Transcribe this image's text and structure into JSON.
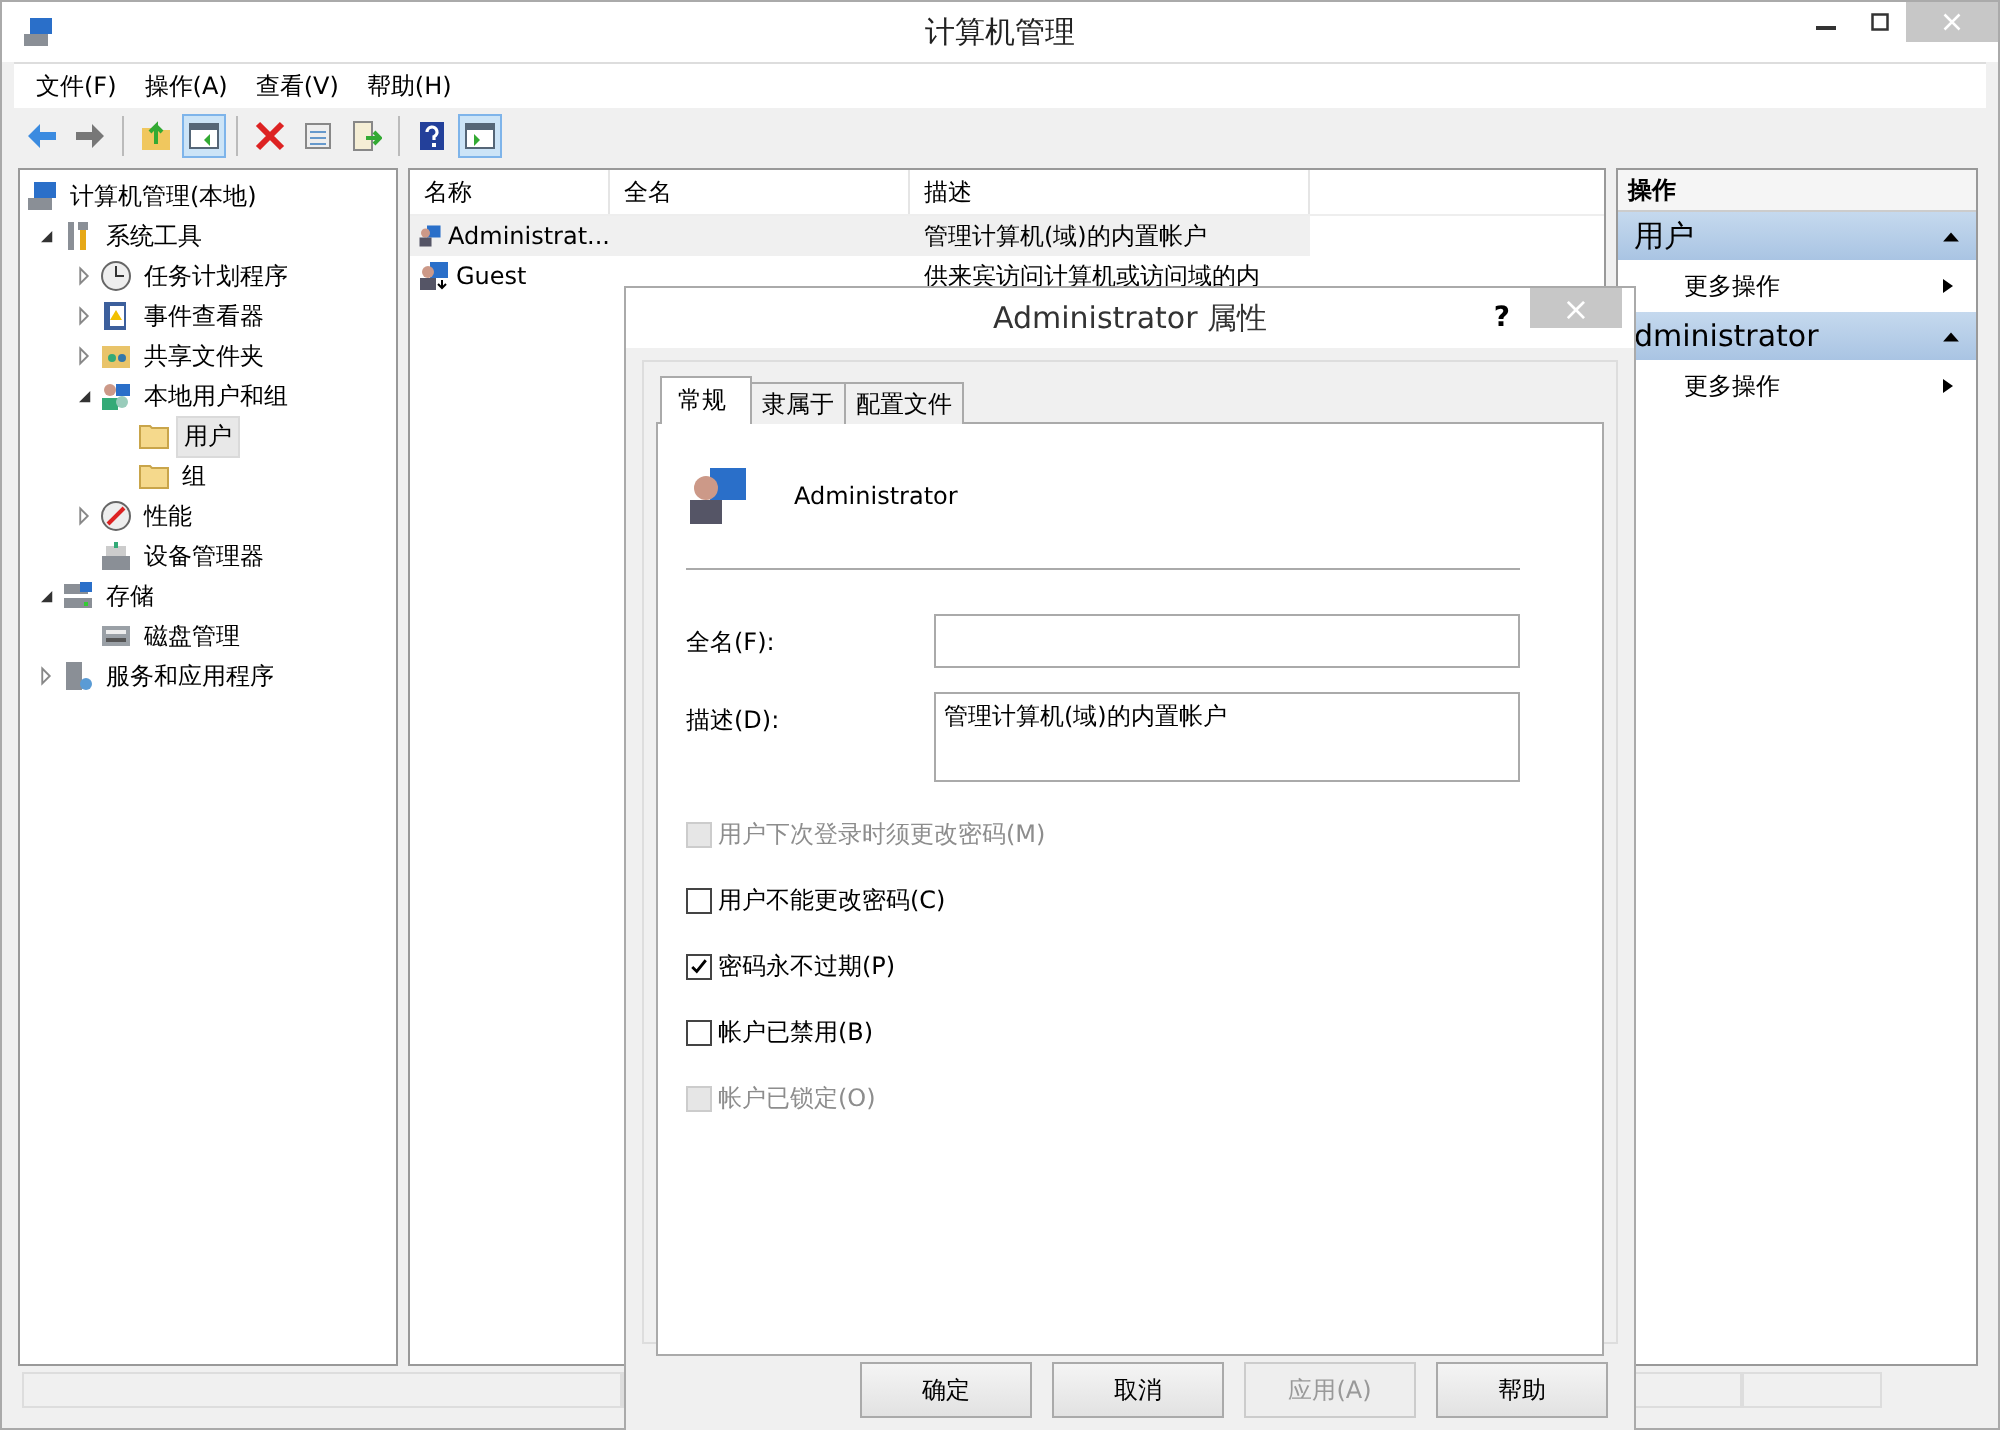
{
  "window": {
    "title": "计算机管理"
  },
  "menu": [
    "文件(F)",
    "操作(A)",
    "查看(V)",
    "帮助(H)"
  ],
  "toolbar": [
    {
      "kind": "back",
      "selected": false
    },
    {
      "kind": "forward",
      "selected": false
    },
    {
      "kind": "sep"
    },
    {
      "kind": "up",
      "selected": false
    },
    {
      "kind": "tree",
      "selected": true
    },
    {
      "kind": "sep"
    },
    {
      "kind": "delete",
      "selected": false
    },
    {
      "kind": "props",
      "selected": false
    },
    {
      "kind": "export",
      "selected": false
    },
    {
      "kind": "sep"
    },
    {
      "kind": "help",
      "selected": false
    },
    {
      "kind": "pane",
      "selected": true
    }
  ],
  "tree": [
    {
      "label": "计算机管理(本地)",
      "kind": "computer",
      "selected": false,
      "children": [
        {
          "label": "系统工具",
          "kind": "tools",
          "expanded": true,
          "selected": false,
          "children": [
            {
              "label": "任务计划程序",
              "kind": "clock",
              "expanded": false,
              "selected": false
            },
            {
              "label": "事件查看器",
              "kind": "event",
              "expanded": false,
              "selected": false
            },
            {
              "label": "共享文件夹",
              "kind": "share",
              "expanded": false,
              "selected": false
            },
            {
              "label": "本地用户和组",
              "kind": "users",
              "expanded": true,
              "selected": false,
              "children": [
                {
                  "label": "用户",
                  "kind": "folder",
                  "selected": true
                },
                {
                  "label": "组",
                  "kind": "folder",
                  "selected": false
                }
              ]
            },
            {
              "label": "性能",
              "kind": "perf",
              "expanded": false,
              "selected": false
            },
            {
              "label": "设备管理器",
              "kind": "device",
              "selected": false
            }
          ]
        },
        {
          "label": "存储",
          "kind": "storage",
          "expanded": true,
          "selected": false,
          "children": [
            {
              "label": "磁盘管理",
              "kind": "disk",
              "selected": false
            }
          ]
        },
        {
          "label": "服务和应用程序",
          "kind": "services",
          "expanded": false,
          "selected": false
        }
      ]
    }
  ],
  "list": {
    "columns": [
      "名称",
      "全名",
      "描述"
    ],
    "rows": [
      {
        "name": "Administrat...",
        "kind": "admin",
        "description": "管理计算机(域)的内置帐户",
        "selected": true
      },
      {
        "name": "Guest",
        "kind": "guest",
        "description": "供来宾访问计算机或访问域的内",
        "selected": false
      }
    ]
  },
  "actions": {
    "title": "操作",
    "sections": [
      {
        "title": "用户",
        "expanded": true,
        "items": [
          "更多操作"
        ]
      },
      {
        "title": "dministrator",
        "expanded": true,
        "items": [
          "更多操作"
        ]
      }
    ]
  },
  "dialog": {
    "title": "Administrator 属性",
    "help": "?",
    "close": "×",
    "tabs": [
      {
        "label": "常规",
        "selected": true
      },
      {
        "label": "隶属于",
        "selected": false
      },
      {
        "label": "配置文件",
        "selected": false
      }
    ],
    "user_name": "Administrator",
    "fields": [
      {
        "label": "全名(F):",
        "kind": "line"
      },
      {
        "label": "描述(D):",
        "value": "管理计算机(域)的内置帐户",
        "kind": "area"
      }
    ],
    "checkboxes": [
      {
        "label": "用户下次登录时须更改密码(M)",
        "checked": false,
        "disabled": true
      },
      {
        "label": "用户不能更改密码(C)",
        "checked": false,
        "disabled": false
      },
      {
        "label": "密码永不过期(P)",
        "checked": true,
        "disabled": false
      },
      {
        "label": "帐户已禁用(B)",
        "checked": false,
        "disabled": false
      },
      {
        "label": "帐户已锁定(O)",
        "checked": false,
        "disabled": true
      }
    ],
    "buttons": [
      {
        "label": "确定",
        "disabled": false
      },
      {
        "label": "取消",
        "disabled": false
      },
      {
        "label": "应用(A)",
        "disabled": true
      },
      {
        "label": "帮助",
        "disabled": false
      }
    ]
  }
}
